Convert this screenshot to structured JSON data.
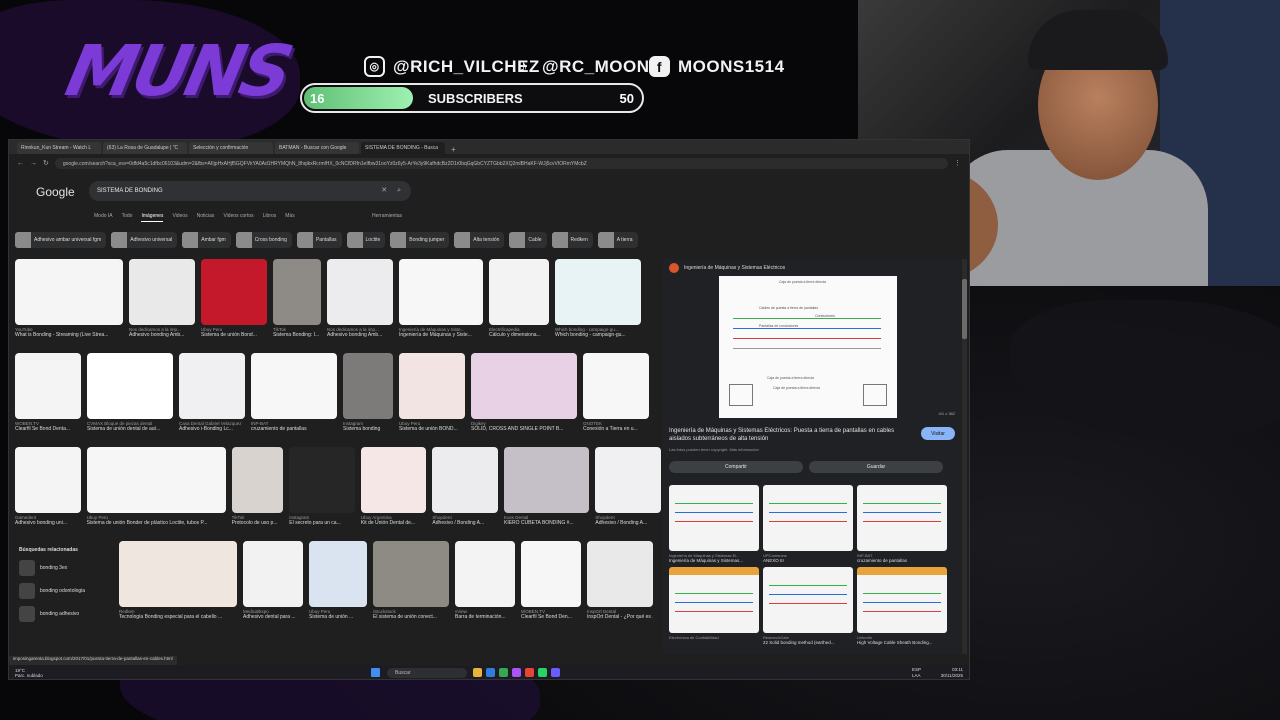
{
  "overlay": {
    "logo": "MUNS",
    "socials": [
      {
        "icon": "instagram-icon",
        "handle": "@RICH_VILCHEZ"
      },
      {
        "icon": "tiktok-icon",
        "handle": "@RC_MOONS"
      },
      {
        "icon": "facebook-icon",
        "handle": "MOONS1514"
      }
    ],
    "subscribers": {
      "current": "16",
      "label": "SUBSCRIBERS",
      "goal": "50",
      "progress": 0.32
    }
  },
  "browser": {
    "tabs": [
      {
        "label": "Rinnkun_Kun Stream - Watch L"
      },
      {
        "label": "(63) La Rosa de Guadalupe | \"C"
      },
      {
        "label": "Selección y confirmación"
      },
      {
        "label": "BATMAN - Buscar con Google"
      },
      {
        "label": "SISTEMA DE BONDING - Busca"
      }
    ],
    "url": "google.com/search?sca_esv=0dfd4a5c1dfbc06103&udm=2&fbs=AIIjpHxAHjf5GQFVkYA0Ad1HRYMQhN_8hqikxRcrmlHX_0cNCfDRfn1eIfbw31ooYz0z6y5-ArYe3y9KafhdcBz2D1r0bqGqGbCYZTGbb2XQ2mlBHaKF-WJj5cvVIORmYMcbZ",
    "google_logo": "Google",
    "search_query": "SISTEMA DE BONDING",
    "search_tabs": [
      "Modo IA",
      "Todo",
      "Imágenes",
      "Videos",
      "Noticias",
      "Videos cortos",
      "Libros",
      "Más"
    ],
    "active_search_tab": "Imágenes",
    "tools_label": "Herramientas",
    "chips": [
      "Adhesivo ambar universal fgm",
      "Adhesivo universal",
      "Ambar fgm",
      "Cross bonding",
      "Pantallas",
      "Loctite",
      "Bonding jumper",
      "Alta tensión",
      "Cable",
      "Redken",
      "A tierra"
    ],
    "results": [
      [
        {
          "src": "YouTube",
          "cap": "What is Bonding - Streaming (Live Strea...",
          "color": "#f5f5f5",
          "w": 108
        },
        {
          "src": "Nos dedicamos a la imp...",
          "cap": "Adhesivo bonding Amb...",
          "color": "#e9e9ea",
          "w": 66
        },
        {
          "src": "Ubuy Peru",
          "cap": "Sistema de unión Bond...",
          "color": "#c4192a",
          "w": 66
        },
        {
          "src": "TikTok",
          "cap": "Sistema Bonding: I...",
          "color": "#8e8a86",
          "w": 48
        },
        {
          "src": "Nos dedicamos a la imp...",
          "cap": "Adhesivo bonding Amb...",
          "color": "#ececee",
          "w": 66
        },
        {
          "src": "Ingeniería de Máquinas y Siste...",
          "cap": "Ingeniería de Máquinas y Siste...",
          "color": "#f7f7f7",
          "w": 84
        },
        {
          "src": "Electrificapedia",
          "cap": "Cálculo y dimensiona...",
          "color": "#f3f3f3",
          "w": 60
        },
        {
          "src": "Which bonding - campaign-gu...",
          "cap": "Which bonding - campaign-gu...",
          "color": "#e7f3f4",
          "w": 86
        }
      ],
      [
        {
          "src": "WOBEN.TV",
          "cap": "Clearfil Se Bond Denta...",
          "color": "#f4f4f4",
          "w": 66
        },
        {
          "src": "CVMAX Bloque de piezas dental",
          "cap": "Sistema de unión dental de aut...",
          "color": "#ffffff",
          "w": 86
        },
        {
          "src": "Casa Dental Gabriel Velazquez",
          "cap": "Adhesivo i-Bonding Lc...",
          "color": "#f0f0f2",
          "w": 66
        },
        {
          "src": "INP-BAT",
          "cap": "cruzamiento de pantallas",
          "color": "#f7f7f7",
          "w": 86
        },
        {
          "src": "Instagram",
          "cap": "Sistema bonding",
          "color": "#7d7a7a",
          "w": 50
        },
        {
          "src": "Ubuy Peru",
          "cap": "Sistema de unión BOND...",
          "color": "#f1e4e3",
          "w": 66
        },
        {
          "src": "Digikey",
          "cap": "SOLID, CROSS AND SINGLE POINT B...",
          "color": "#e9d1e5",
          "w": 106
        },
        {
          "src": "GNOTEK",
          "cap": "Conexión a Tierra en u...",
          "color": "#f7f7f7",
          "w": 66
        }
      ],
      [
        {
          "src": "Gamedent",
          "cap": "Adhesivo bonding uni...",
          "color": "#f4f4f4",
          "w": 66
        },
        {
          "src": "Ubuy Peru",
          "cap": "Sistema de unión Bonder de plástico Loctite, tubos P...",
          "color": "#f6f6f6",
          "w": 140
        },
        {
          "src": "TikTok",
          "cap": "Protocolo de uso p...",
          "color": "#d8d3cf",
          "w": 52
        },
        {
          "src": "Instagram",
          "cap": "El secreto para un ca...",
          "color": "#262626",
          "w": 66
        },
        {
          "src": "Ubuy Argentina",
          "cap": "Kit de Unión Dental de...",
          "color": "#f4e7e5",
          "w": 66
        },
        {
          "src": "Shopdent",
          "cap": "Adhesivo / Bonding A...",
          "color": "#ececee",
          "w": 66
        },
        {
          "src": "Kuss Dental",
          "cap": "KIERO CUBETA BONDING #...",
          "color": "#c5c0c7",
          "w": 86
        },
        {
          "src": "Shopdent",
          "cap": "Adhesivo / Bonding A...",
          "color": "#f0f0f2",
          "w": 66
        }
      ],
      [
        {
          "src": "Redken",
          "cap": "Tecnología Bonding especial para el cabello ...",
          "color": "#efe6e0",
          "w": 118
        },
        {
          "src": "MedicalExpo",
          "cap": "Adhesivo dental para ...",
          "color": "#f2f2f2",
          "w": 60
        },
        {
          "src": "Ubuy Peru",
          "cap": "Sistema de unión ...",
          "color": "#d9e4f0",
          "w": 58
        },
        {
          "src": "iStockstock",
          "cap": "El sistema de unión conect...",
          "color": "#8e8b84",
          "w": 76
        },
        {
          "src": "vView",
          "cap": "Barra de terminación...",
          "color": "#f3f3f3",
          "w": 60
        },
        {
          "src": "WOBEN.TV",
          "cap": "Clearfil Se Bond Den...",
          "color": "#f6f6f6",
          "w": 60
        },
        {
          "src": "InspOrt Dental",
          "cap": "InspOrt Dental - ¿Por qué es ...",
          "color": "#e9e9e9",
          "w": 66
        }
      ]
    ],
    "related": {
      "title": "Búsquedas relacionadas",
      "items": [
        "bonding 3ex",
        "bonding odontologia",
        "bonding adhesivo"
      ]
    },
    "panel": {
      "source": "Ingeniería de Máquinas y Sistemas Eléctricos",
      "counter": "4/1 x 382",
      "title": "Ingeniería de Máquinas y Sistemas Eléctricos: Puesta a tierra de pantallas en cables aislados subterráneos de alta tensión",
      "visit": "Visitar",
      "copyright": "Las fotos pueden tener copyright. Más información",
      "share": "Compartir",
      "save": "Guardar",
      "diagram_labels": [
        "Caja de puesta a tierra directa",
        "Cables de puesta a tierra de pantallas",
        "Conductores",
        "Pantallas de conductores",
        "Caja de puesta a tierra directa",
        "Caja de puesta a tierra directa"
      ],
      "more": [
        {
          "src": "Ingeniería de Máquinas y Sistemas El...",
          "cap": "Ingeniería de Máquinas y Sistemas..."
        },
        {
          "src": "UPCommons",
          "cap": "ANEXO III"
        },
        {
          "src": "INP-BAT",
          "cap": "cruzamiento de pantallas"
        },
        {
          "src": "Electrónica de Confiabilidad",
          "cap": ""
        },
        {
          "src": "ResearchGate",
          "cap": "22 Solid bonding method (earthed..."
        },
        {
          "src": "LinkedIn",
          "cap": "High Voltage Cable Sheath Bonding..."
        }
      ]
    },
    "status_url": "imposingarenta.blogspot.com/2017/01/puesta-tierra-de-pantallas-en-cables.html"
  },
  "taskbar": {
    "weather": "19°C",
    "weather_desc": "Parc. nublado",
    "search": "Buscar",
    "lang": "ESP",
    "lang2": "LAA",
    "time": "03:11",
    "date": "30/11/2025"
  }
}
